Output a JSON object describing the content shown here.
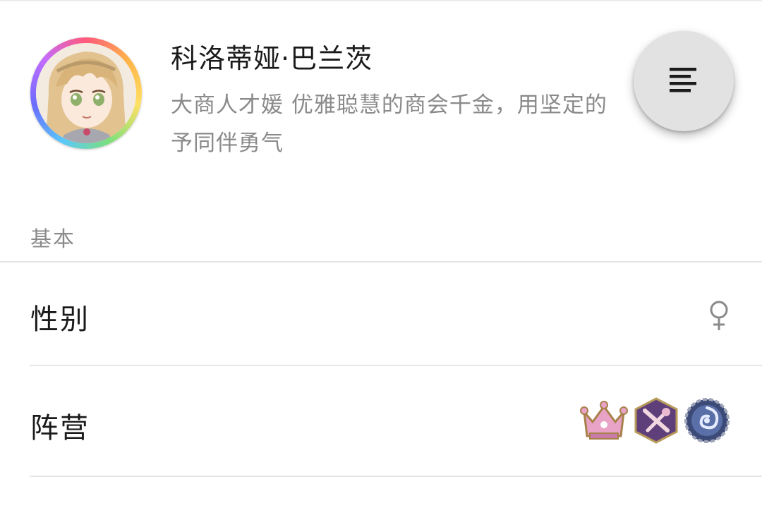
{
  "header": {
    "name": "科洛蒂娅·巴兰茨",
    "description_line1": "大商人才媛 优雅聪慧的商会千金，用坚定的",
    "description_line2": "予同伴勇气",
    "avatar_icon": "character-portrait-icon"
  },
  "fab": {
    "icon": "menu-icon"
  },
  "section": {
    "label": "基本"
  },
  "rows": [
    {
      "label": "性别",
      "value_icon": "female-symbol-icon"
    },
    {
      "label": "阵营",
      "value_icons": [
        "crown-faction-icon",
        "crossed-tools-faction-icon",
        "vortex-gear-faction-icon"
      ]
    }
  ],
  "colors": {
    "text_primary": "#1a1a1a",
    "text_secondary": "#8a8a8a",
    "fab_background": "#e2e2e2",
    "divider": "#e6e6e6",
    "faction_crown": "#d97fb0",
    "faction_tools": "#6b4c8a",
    "faction_vortex": "#5a6fa8"
  }
}
